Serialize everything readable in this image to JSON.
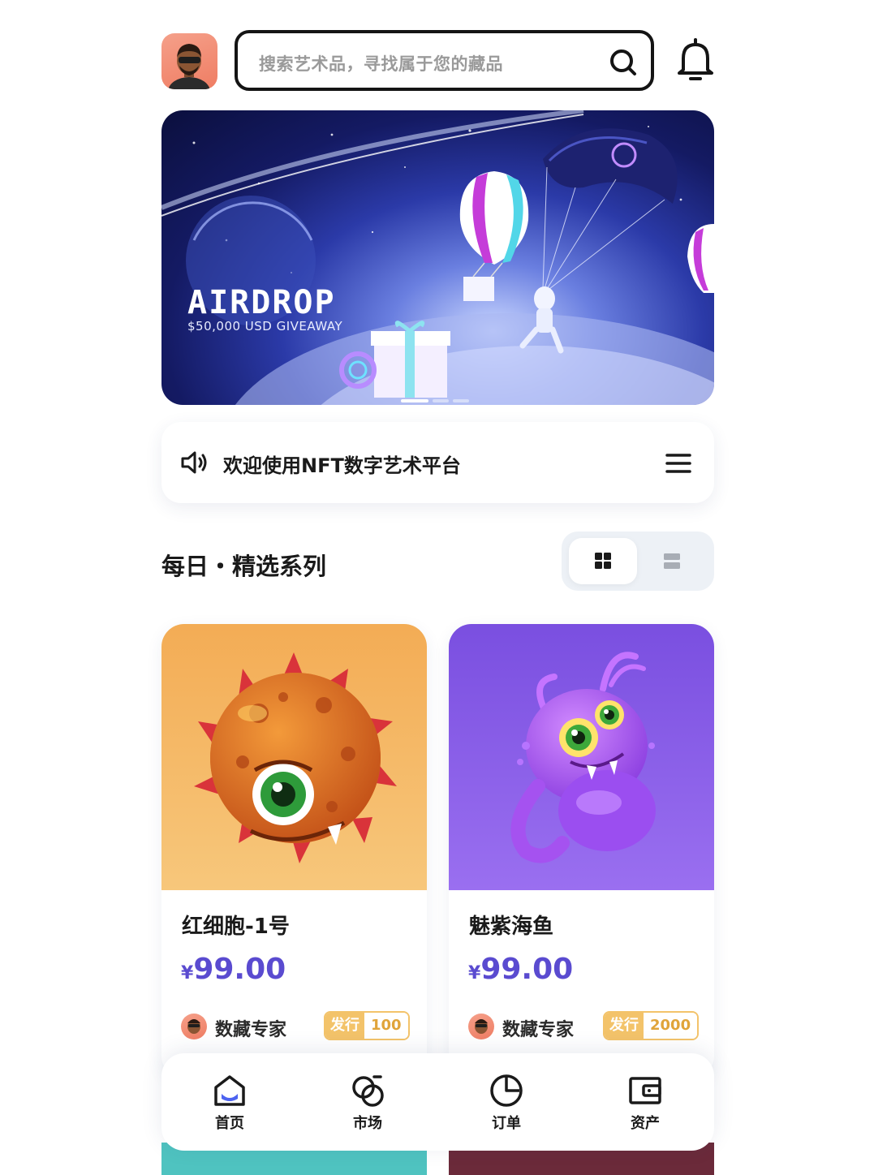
{
  "header": {
    "search_placeholder": "搜索艺术品，寻找属于您的藏品"
  },
  "banner": {
    "title": "AIRDROP",
    "subtitle": "$50,000 USD GIVEAWAY"
  },
  "notice": {
    "text": "欢迎使用NFT数字艺术平台"
  },
  "section": {
    "title": "每日・精选系列"
  },
  "cards": [
    {
      "name": "红细胞-1号",
      "currency": "¥",
      "price": "99.00",
      "creator": "数藏专家",
      "issue_label": "发行",
      "issue_count": "100",
      "bg_color": "#f6b95e"
    },
    {
      "name": "魅紫海鱼",
      "currency": "¥",
      "price": "99.00",
      "creator": "数藏专家",
      "issue_label": "发行",
      "issue_count": "2000",
      "bg_color": "#8a5ce6"
    }
  ],
  "nav": {
    "items": [
      {
        "label": "首页",
        "icon": "home-icon",
        "active": true
      },
      {
        "label": "市场",
        "icon": "market-icon"
      },
      {
        "label": "订单",
        "icon": "orders-icon"
      },
      {
        "label": "资产",
        "icon": "wallet-icon"
      }
    ]
  },
  "colors": {
    "accent": "#5a4bd0",
    "badge": "#f3c36a",
    "nav_active": "#4d63f0"
  }
}
